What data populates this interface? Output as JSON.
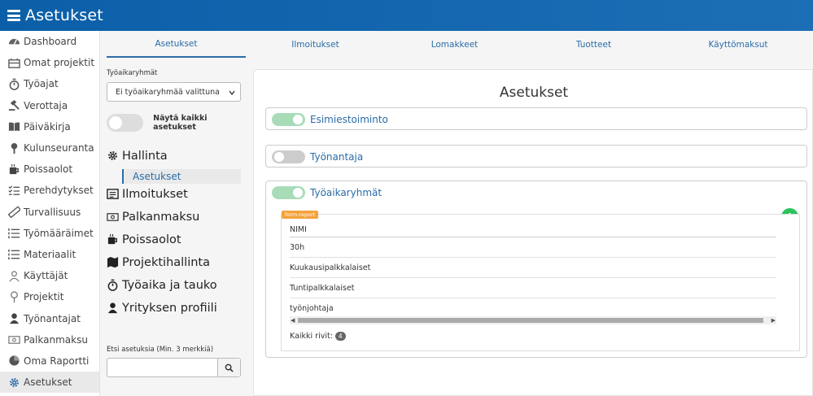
{
  "app": {
    "title": "Asetukset"
  },
  "sidebar": {
    "items": [
      {
        "label": "Dashboard",
        "icon": "dashboard-icon"
      },
      {
        "label": "Omat projektit",
        "icon": "projects-icon"
      },
      {
        "label": "Työajat",
        "icon": "stopwatch-icon"
      },
      {
        "label": "Verottaja",
        "icon": "gavel-icon"
      },
      {
        "label": "Päiväkirja",
        "icon": "book-icon"
      },
      {
        "label": "Kulunseuranta",
        "icon": "map-pin-icon"
      },
      {
        "label": "Poissaolot",
        "icon": "coffee-icon"
      },
      {
        "label": "Perehdytykset",
        "icon": "checklist-icon"
      },
      {
        "label": "Turvallisuus",
        "icon": "ruler-icon"
      },
      {
        "label": "Työmääräimet",
        "icon": "list-icon"
      },
      {
        "label": "Materiaalit",
        "icon": "list-icon"
      },
      {
        "label": "Käyttäjät",
        "icon": "users-icon"
      },
      {
        "label": "Projektit",
        "icon": "pin-icon"
      },
      {
        "label": "Työnantajat",
        "icon": "user-icon"
      },
      {
        "label": "Palkanmaksu",
        "icon": "money-icon"
      },
      {
        "label": "Oma Raportti",
        "icon": "pie-chart-icon"
      },
      {
        "label": "Asetukset",
        "icon": "gear-icon",
        "active": true
      }
    ]
  },
  "tabs": [
    "Asetukset",
    "Ilmoitukset",
    "Lomakkeet",
    "Tuotteet",
    "Käyttömaksut"
  ],
  "left": {
    "group_label": "Työaikaryhmät",
    "group_select": "Ei työaikaryhmää valittuna",
    "show_all_label": "Näytä kaikki asetukset",
    "categories": [
      {
        "label": "Hallinta",
        "icon": "gear-icon"
      },
      {
        "label": "Ilmoitukset",
        "icon": "newspaper-icon"
      },
      {
        "label": "Palkanmaksu",
        "icon": "money-icon"
      },
      {
        "label": "Poissaolot",
        "icon": "coffee-icon"
      },
      {
        "label": "Projektihallinta",
        "icon": "map-icon"
      },
      {
        "label": "Työaika ja tauko",
        "icon": "stopwatch-icon"
      },
      {
        "label": "Yrityksen profiili",
        "icon": "user-icon"
      }
    ],
    "sub_selected": "Asetukset",
    "search_label": "Etsi asetuksia (Min. 3 merkkiä)",
    "search_placeholder": ""
  },
  "main": {
    "title": "Asetukset",
    "sections": [
      {
        "title": "Esimiestoiminto",
        "enabled": true
      },
      {
        "title": "Työnantaja",
        "enabled": false
      },
      {
        "title": "Työaikaryhmät",
        "enabled": true
      }
    ],
    "report": {
      "badge": "form-report",
      "column": "NIMI",
      "rows": [
        "30h",
        "Kuukausipalkkalaiset",
        "Tuntipalkkalaiset",
        "työnjohtaja"
      ],
      "count_label": "Kaikki rivit:",
      "count": "4"
    }
  },
  "colors": {
    "header": "#0b5fa8",
    "accent": "#2a6ca8",
    "toggle_on": "#a8dcb9",
    "add": "#29c45b",
    "badge": "#f4a23c"
  }
}
